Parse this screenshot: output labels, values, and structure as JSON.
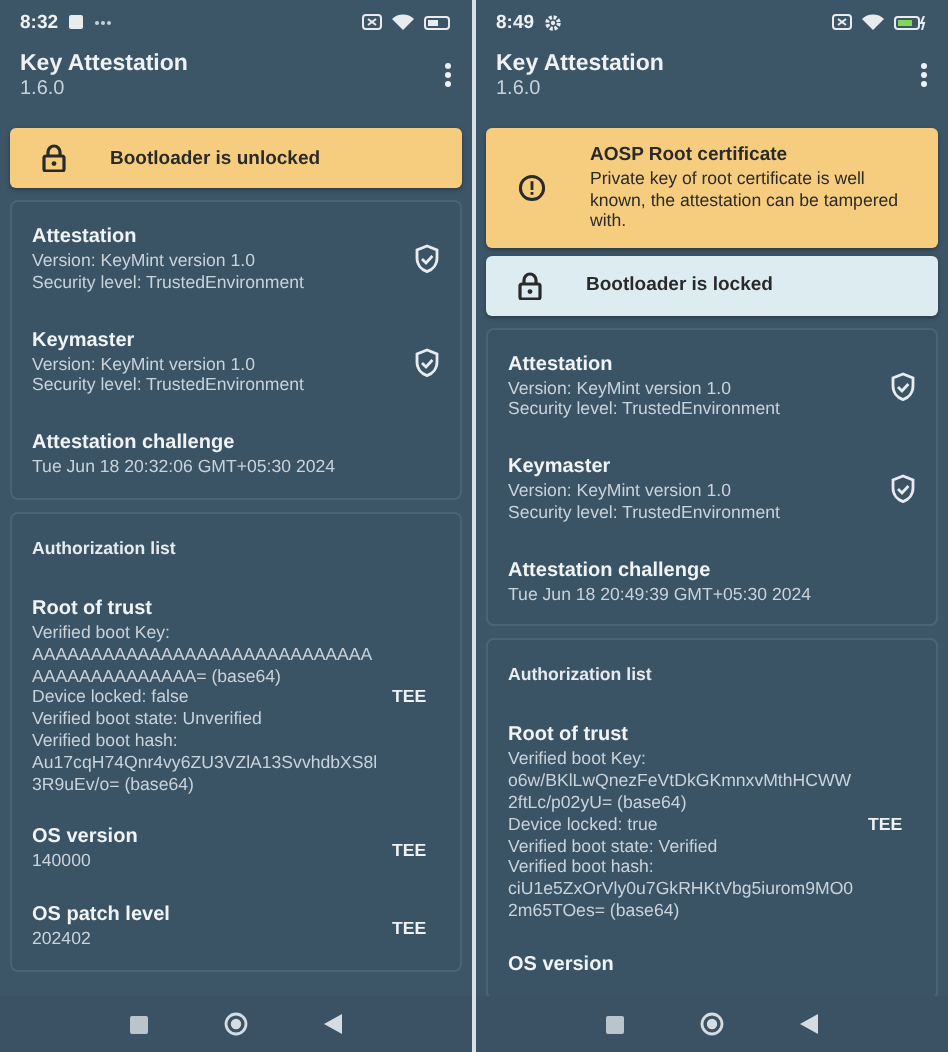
{
  "phones": [
    {
      "status_bar": {
        "time": "8:32",
        "charging": false
      },
      "app_bar": {
        "title": "Key Attestation",
        "version": "1.6.0"
      },
      "banners": [
        {
          "kind": "unlocked",
          "title": "Bootloader is unlocked"
        }
      ],
      "summary": [
        {
          "title": "Attestation",
          "lines": [
            "Version: KeyMint version 1.0",
            "Security level: TrustedEnvironment"
          ],
          "verified": true
        },
        {
          "title": "Keymaster",
          "lines": [
            "Version: KeyMint version 1.0",
            "Security level: TrustedEnvironment"
          ],
          "verified": true
        },
        {
          "title": "Attestation challenge",
          "lines": [
            "Tue Jun 18 20:32:06 GMT+05:30 2024"
          ],
          "verified": false
        }
      ],
      "authorization": {
        "heading": "Authorization list",
        "items": [
          {
            "title": "Root of trust",
            "lines": [
              "Verified boot Key: AAAAAAAAAAAAAAAAAAAAAAAAAAAAAAAAAAAAAAAAAAA= (base64)",
              "Device locked: false",
              "Verified boot state: Unverified",
              "Verified boot hash: Au17cqH74Qnr4vy6ZU3VZlA13SvvhdbXS8l3R9uEv/o= (base64)"
            ],
            "badge": "TEE"
          },
          {
            "title": "OS version",
            "lines": [
              "140000"
            ],
            "badge": "TEE"
          },
          {
            "title": "OS patch level",
            "lines": [
              "202402"
            ],
            "badge": "TEE"
          }
        ]
      }
    },
    {
      "status_bar": {
        "time": "8:49",
        "charging": true
      },
      "app_bar": {
        "title": "Key Attestation",
        "version": "1.6.0"
      },
      "banners": [
        {
          "kind": "warning",
          "title": "AOSP Root certificate",
          "text": "Private key of root certificate is well known, the attestation can be tampered with."
        },
        {
          "kind": "locked",
          "title": "Bootloader is locked"
        }
      ],
      "summary": [
        {
          "title": "Attestation",
          "lines": [
            "Version: KeyMint version 1.0",
            "Security level: TrustedEnvironment"
          ],
          "verified": true
        },
        {
          "title": "Keymaster",
          "lines": [
            "Version: KeyMint version 1.0",
            "Security level: TrustedEnvironment"
          ],
          "verified": true
        },
        {
          "title": "Attestation challenge",
          "lines": [
            "Tue Jun 18 20:49:39 GMT+05:30 2024"
          ],
          "verified": false
        }
      ],
      "authorization": {
        "heading": "Authorization list",
        "items": [
          {
            "title": "Root of trust",
            "lines": [
              "Verified boot Key: o6w/BKlLwQnezFeVtDkGKmnxvMthHCWW2ftLc/p02yU= (base64)",
              "Device locked: true",
              "Verified boot state: Verified",
              "Verified boot hash: ciU1e5ZxOrVly0u7GkRHKtVbg5iurom9MO02m65TOes= (base64)"
            ],
            "badge": "TEE"
          },
          {
            "title": "OS version"
          }
        ]
      }
    }
  ]
}
